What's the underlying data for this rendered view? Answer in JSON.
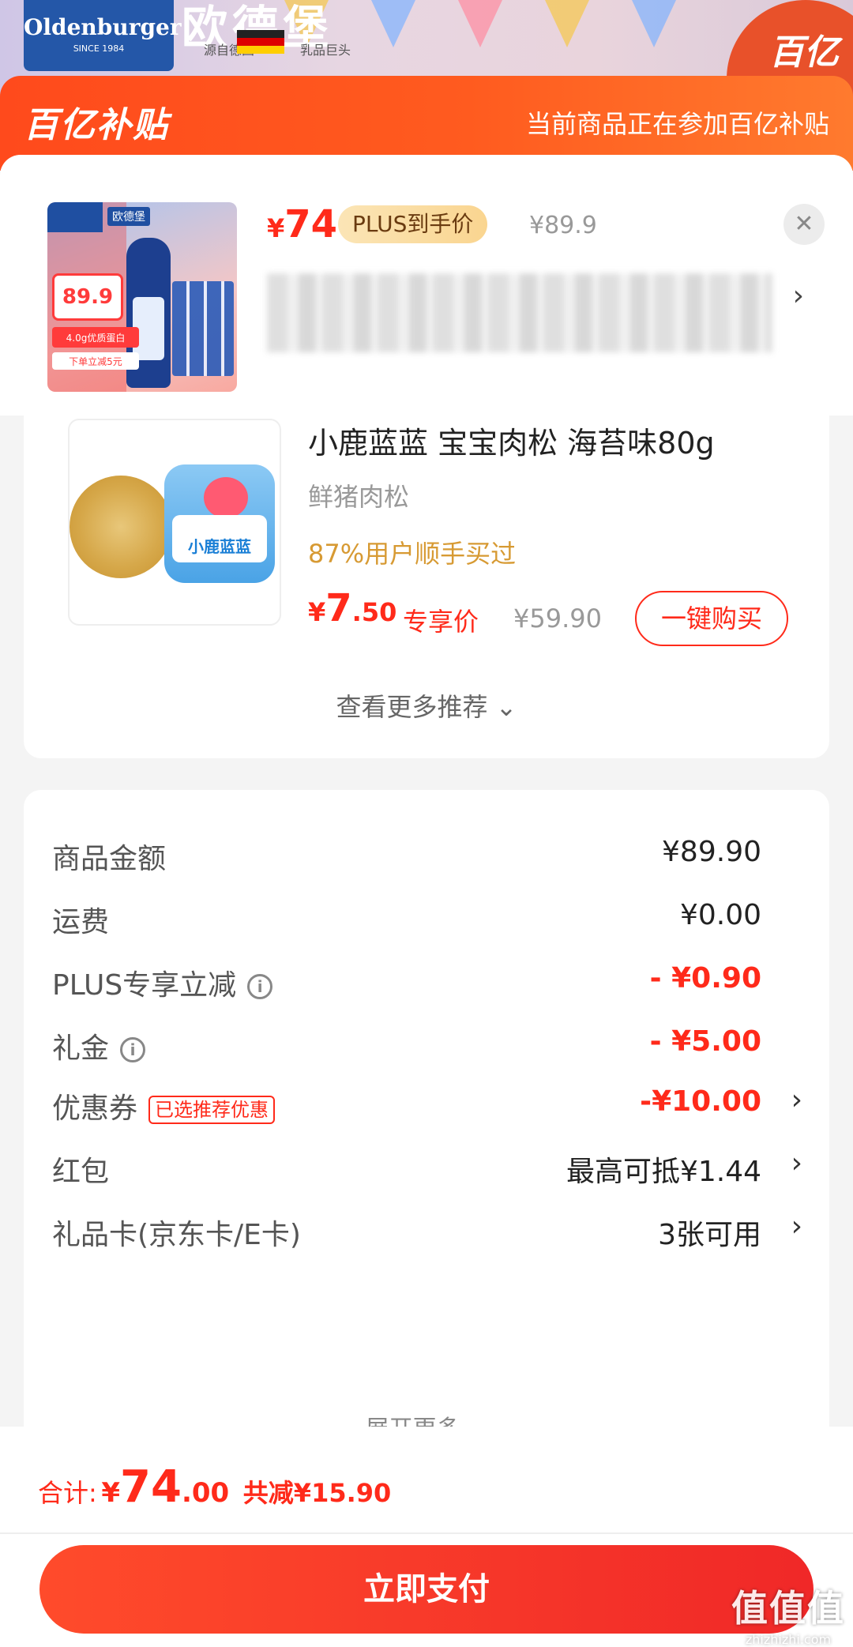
{
  "banner": {
    "brand_logo": "Oldenburger",
    "brand_logo_since": "SINCE 1984",
    "brand_cn": "欧德堡",
    "sub_left": "源自德国",
    "sub_right": "乳品巨头",
    "corner_logo": "百亿"
  },
  "subsidy": {
    "logo": "百亿补贴",
    "message": "当前商品正在参加百亿补贴"
  },
  "product_head": {
    "thumb_brand": "欧德堡",
    "thumb_badge_price": "89.9",
    "thumb_tag": "4.0g优质蛋白",
    "thumb_tag2": "下单立减5元",
    "currency": "¥",
    "price": "74",
    "plus_label": "PLUS到手价",
    "original_price": "¥89.9",
    "close_icon": "close-icon",
    "arrow": "›"
  },
  "recommendation": {
    "title": "小鹿蓝蓝 宝宝肉松 海苔味80g",
    "subtitle": "鲜猪肉松",
    "hint": "87%用户顺手买过",
    "currency": "¥",
    "price_int": "7",
    "price_dec": ".50",
    "price_tag": "专享价",
    "original_price": "¥59.90",
    "buy_button": "一键购买",
    "jar_label": "小鹿蓝蓝",
    "more": "查看更多推荐 ⌄"
  },
  "summary": {
    "rows": [
      {
        "label": "商品金额",
        "value": "¥89.90"
      },
      {
        "label": "运费",
        "value": "¥0.00"
      },
      {
        "label": "PLUS专享立减",
        "value": "- ¥0.90"
      },
      {
        "label": "礼金",
        "value": "- ¥5.00"
      },
      {
        "label": "优惠券",
        "tag": "已选推荐优惠",
        "value": "-¥10.00"
      },
      {
        "label": "红包",
        "value": "最高可抵¥1.44"
      },
      {
        "label": "礼品卡(京东卡/E卡)",
        "value": "3张可用"
      }
    ],
    "expand": "展开更多 ⌄",
    "chevron": "›",
    "info_icon": "i"
  },
  "footer": {
    "total_label": "合计:",
    "currency": "¥",
    "total_int": "74",
    "total_dec": ".00",
    "saved": "共减¥15.90",
    "pay_button": "立即支付",
    "watermark": "值值值",
    "watermark_url": "zhizhizhi.com"
  },
  "colors": {
    "accent": "#ff2a1a",
    "subsidy_orange": "#ff5b1f",
    "plus_gold": "#fad590"
  }
}
